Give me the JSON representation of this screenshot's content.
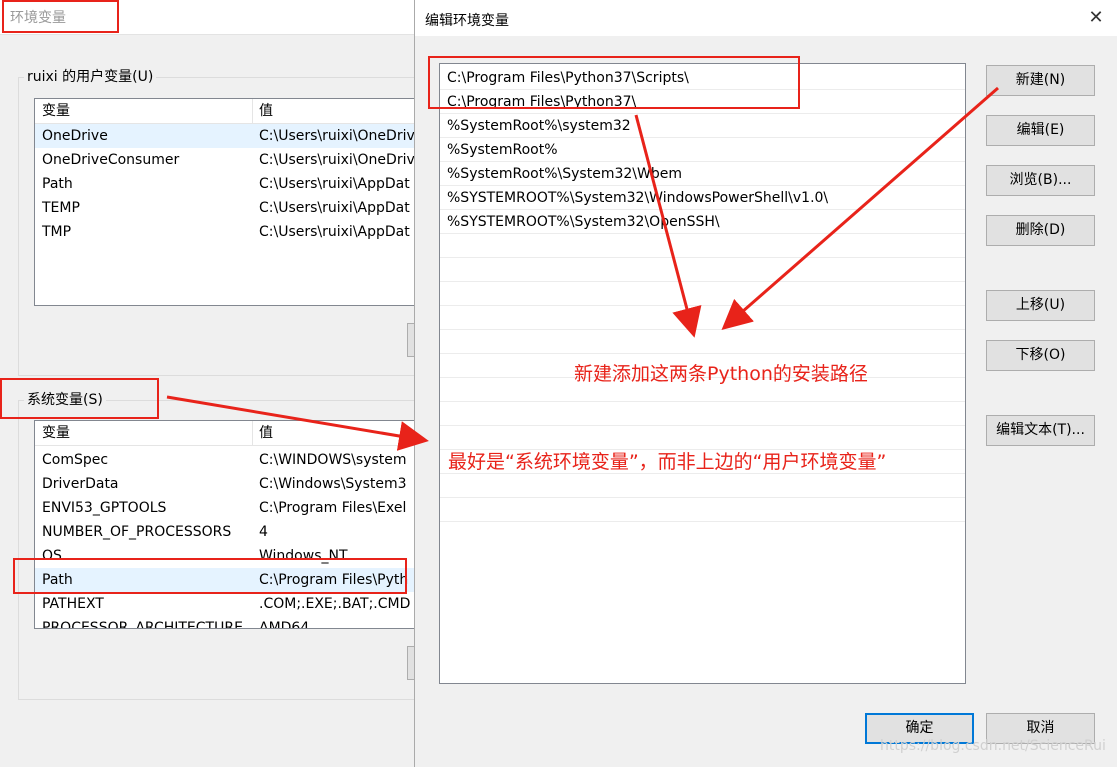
{
  "bg_window": {
    "title": "环境变量",
    "user_group": {
      "label": "ruixi 的用户变量(U)",
      "headers": [
        "变量",
        "值"
      ],
      "rows": [
        [
          "OneDrive",
          "C:\\Users\\ruixi\\OneDriv"
        ],
        [
          "OneDriveConsumer",
          "C:\\Users\\ruixi\\OneDriv"
        ],
        [
          "Path",
          "C:\\Users\\ruixi\\AppDat"
        ],
        [
          "TEMP",
          "C:\\Users\\ruixi\\AppDat"
        ],
        [
          "TMP",
          "C:\\Users\\ruixi\\AppDat"
        ]
      ]
    },
    "system_group": {
      "label": "系统变量(S)",
      "headers": [
        "变量",
        "值"
      ],
      "rows": [
        [
          "ComSpec",
          "C:\\WINDOWS\\system"
        ],
        [
          "DriverData",
          "C:\\Windows\\System3"
        ],
        [
          "ENVI53_GPTOOLS",
          "C:\\Program Files\\Exel"
        ],
        [
          "NUMBER_OF_PROCESSORS",
          "4"
        ],
        [
          "OS",
          "Windows_NT"
        ],
        [
          "Path",
          "C:\\Program Files\\Pyth"
        ],
        [
          "PATHEXT",
          ".COM;.EXE;.BAT;.CMD"
        ],
        [
          "PROCESSOR_ARCHITECTURE",
          "AMD64"
        ]
      ]
    }
  },
  "dialog": {
    "title": "编辑环境变量",
    "close": "✕",
    "paths": [
      "C:\\Program Files\\Python37\\Scripts\\",
      "C:\\Program Files\\Python37\\",
      "%SystemRoot%\\system32",
      "%SystemRoot%",
      "%SystemRoot%\\System32\\Wbem",
      "%SYSTEMROOT%\\System32\\WindowsPowerShell\\v1.0\\",
      "%SYSTEMROOT%\\System32\\OpenSSH\\"
    ],
    "buttons": {
      "new": "新建(N)",
      "edit": "编辑(E)",
      "browse": "浏览(B)...",
      "delete": "删除(D)",
      "move_up": "上移(U)",
      "move_down": "下移(O)",
      "edit_text": "编辑文本(T)...",
      "ok": "确定",
      "cancel": "取消"
    }
  },
  "annotations": {
    "note1": "新建添加这两条Python的安装路径",
    "note2": "最好是“系统环境变量”，而非上边的“用户环境变量”",
    "color": "#e8231a"
  },
  "watermark": "https://blog.csdn.net/ScienceRui"
}
